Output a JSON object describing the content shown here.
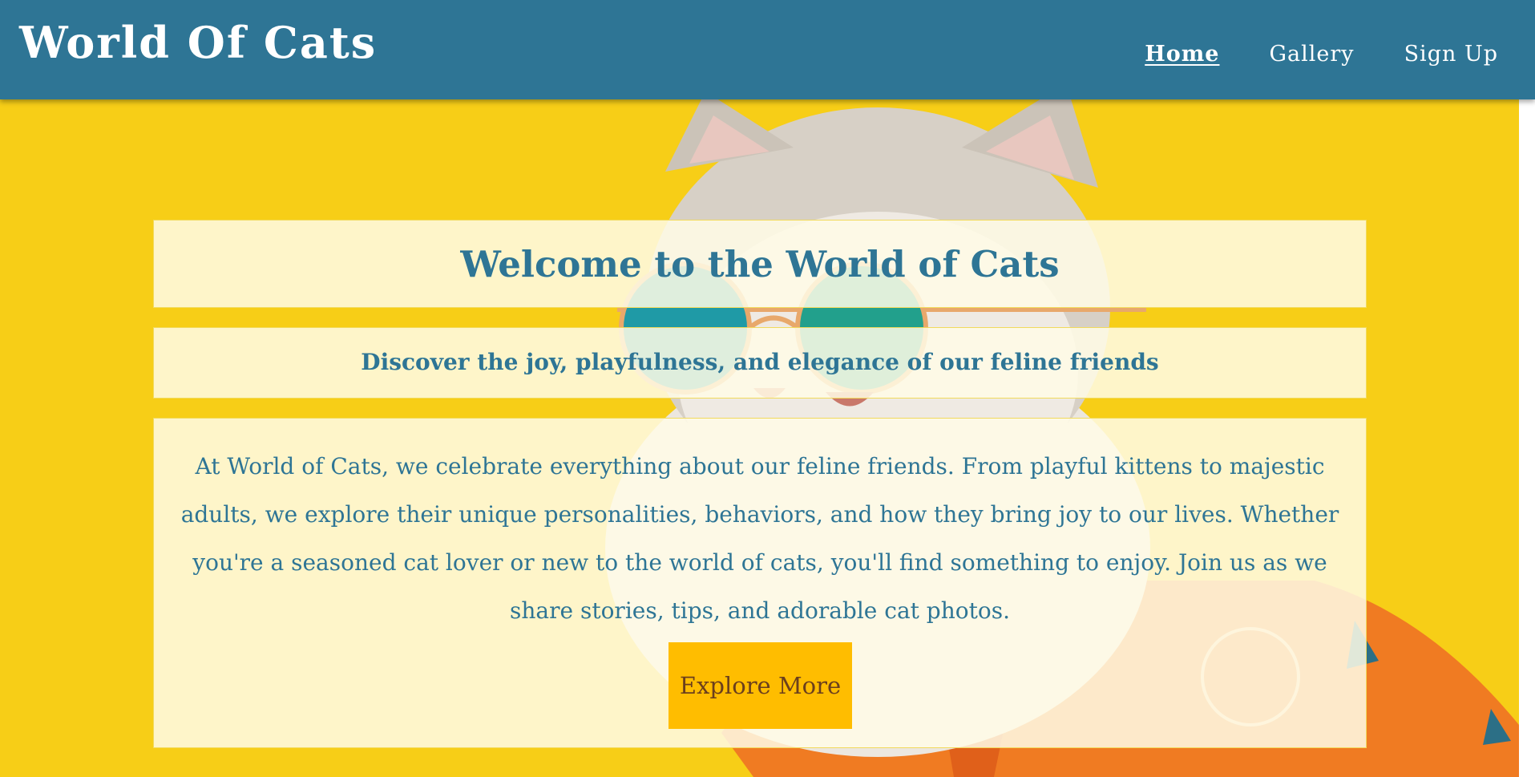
{
  "header": {
    "brand": "World Of Cats",
    "nav": [
      {
        "label": "Home",
        "active": true
      },
      {
        "label": "Gallery",
        "active": false
      },
      {
        "label": "Sign Up",
        "active": false
      }
    ]
  },
  "hero": {
    "title": "Welcome to the World of Cats",
    "subtitle": "Discover the joy, playfulness, and elegance of our feline friends",
    "body": "At World of Cats, we celebrate everything about our feline friends. From playful kittens to majestic adults, we explore their unique personalities, behaviors, and how they bring joy to our lives. Whether you're a seasoned cat lover or new to the world of cats, you'll find something to enjoy. Join us as we share stories, tips, and adorable cat photos.",
    "cta_label": "Explore More"
  },
  "colors": {
    "header_bg": "#2e7595",
    "hero_bg": "#f7ce17",
    "text_accent": "#2e7595",
    "button_bg": "#ffbd00",
    "button_text": "#6b3f1d"
  },
  "icons": {
    "hero_image": "cat-with-sunglasses-image"
  }
}
